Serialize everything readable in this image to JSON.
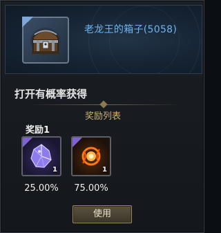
{
  "item": {
    "name": "老龙王的箱子(5058)",
    "icon": "treasure-chest-icon"
  },
  "section_title": "打开有概率获得",
  "reward_list_label": "奖励列表",
  "groups": [
    {
      "label": "奖励1",
      "rewards": [
        {
          "icon": "purple-crystal-icon",
          "quantity": "1",
          "chance": "25.00%",
          "quality_color": "#7f63d6"
        },
        {
          "icon": "flame-orb-icon",
          "quantity": "1",
          "chance": "75.00%",
          "quality_color": "#7f63d6"
        }
      ]
    }
  ],
  "use_button_label": "使用",
  "colors": {
    "title": "#6fb4f0",
    "reward_label": "#c9b27a",
    "button_border": "#a08d63"
  }
}
